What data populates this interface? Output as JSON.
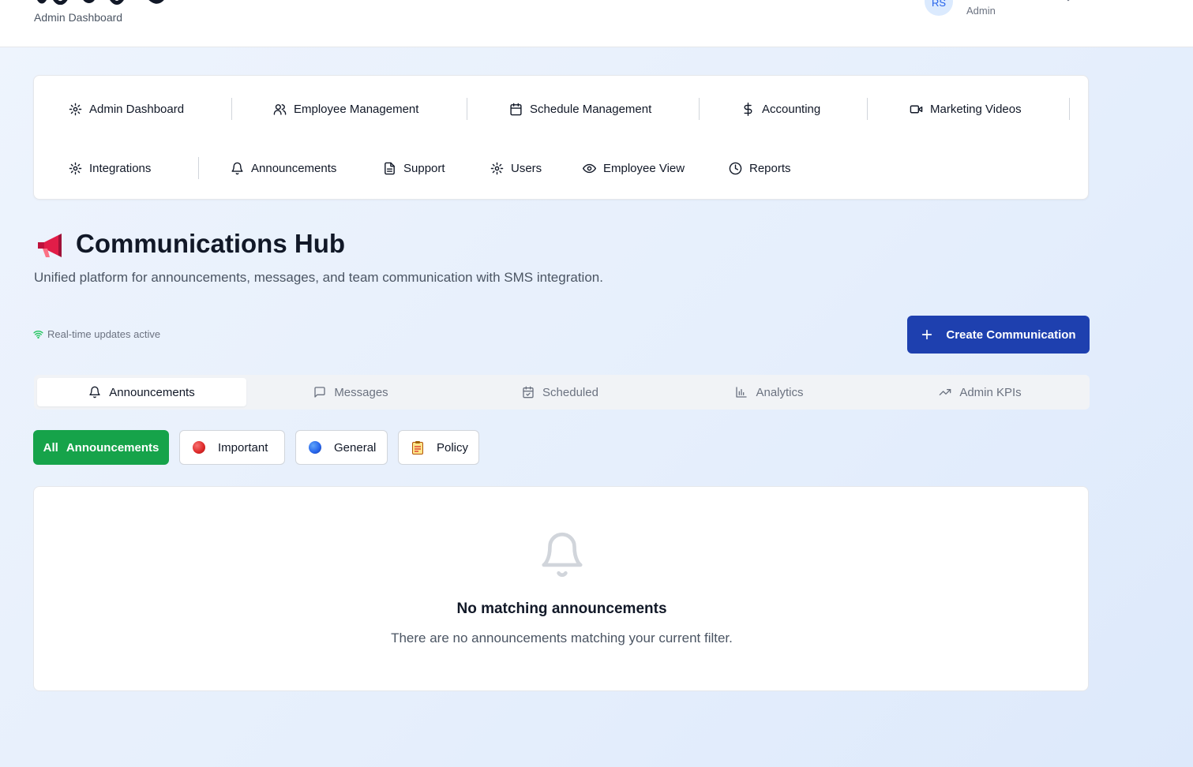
{
  "header": {
    "subtitle": "Admin Dashboard",
    "user_initials": "RS",
    "user_role": "Admin"
  },
  "nav": {
    "items": [
      {
        "label": "Admin Dashboard",
        "icon": "gear-icon"
      },
      {
        "label": "Employee Management",
        "icon": "users-icon"
      },
      {
        "label": "Schedule Management",
        "icon": "calendar-icon"
      },
      {
        "label": "Accounting",
        "icon": "dollar-icon"
      },
      {
        "label": "Marketing Videos",
        "icon": "video-icon"
      },
      {
        "label": "Integrations",
        "icon": "gear-icon"
      },
      {
        "label": "Announcements",
        "icon": "bell-icon"
      },
      {
        "label": "Support",
        "icon": "document-icon"
      },
      {
        "label": "Users",
        "icon": "gear-icon"
      },
      {
        "label": "Employee View",
        "icon": "eye-icon"
      },
      {
        "label": "Reports",
        "icon": "clock-icon"
      }
    ]
  },
  "hero": {
    "icon": "megaphone-icon",
    "title": "Communications Hub",
    "subtitle": "Unified platform for announcements, messages, and team communication with SMS integration."
  },
  "status": {
    "realtime": "Real-time updates active",
    "color": "#22c55e"
  },
  "actions": {
    "create_label": "Create Communication"
  },
  "tabs": [
    {
      "label": "Announcements",
      "icon": "bell-icon",
      "active": true
    },
    {
      "label": "Messages",
      "icon": "message-icon",
      "active": false
    },
    {
      "label": "Scheduled",
      "icon": "calendar-check-icon",
      "active": false
    },
    {
      "label": "Analytics",
      "icon": "bar-chart-icon",
      "active": false
    },
    {
      "label": "Admin KPIs",
      "icon": "trending-up-icon",
      "active": false
    }
  ],
  "filters": [
    {
      "label": "All",
      "label2": "Announcements",
      "active": true
    },
    {
      "label": "Important",
      "icon": "red-circle-icon"
    },
    {
      "label": "General",
      "icon": "blue-circle-icon"
    },
    {
      "label": "Policy",
      "icon": "clipboard-icon"
    }
  ],
  "empty_state": {
    "icon": "bell-icon",
    "title": "No matching announcements",
    "message": "There are no announcements matching your current filter."
  },
  "colors": {
    "primary": "#1e40af",
    "success": "#16a34a",
    "text": "#111827",
    "muted": "#6b7280"
  }
}
